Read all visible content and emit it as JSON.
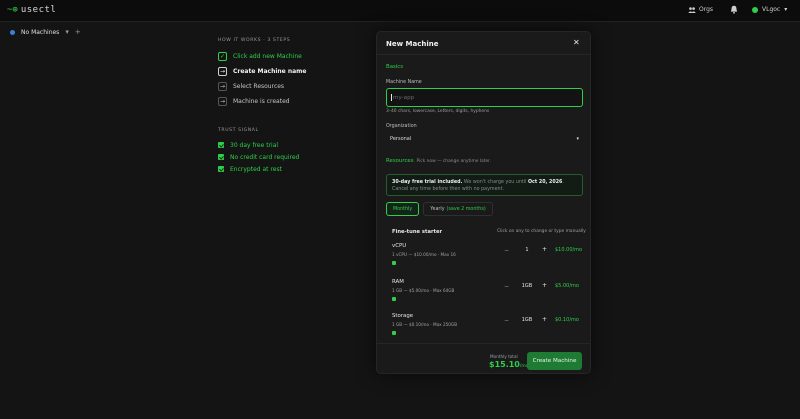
{
  "app": {
    "logo_glyph": "~⊕",
    "name": "usectl"
  },
  "topbar": {
    "orgs_label": "Orgs",
    "user_label": "VLgoc",
    "user_chevron": "▾"
  },
  "tabs": {
    "current": "No Machines",
    "chevron": "▾",
    "plus": "+"
  },
  "steps": {
    "heading": "HOW IT WORKS · 3 STEPS",
    "items": [
      {
        "label": "Click add new Machine",
        "state": "done",
        "mark": "✓"
      },
      {
        "label": "Create Machine name",
        "state": "current",
        "mark": "→"
      },
      {
        "label": "Select Resources",
        "state": "todo",
        "mark": "→"
      },
      {
        "label": "Machine is created",
        "state": "todo",
        "mark": "→"
      }
    ]
  },
  "trust": {
    "heading": "TRUST SIGNAL",
    "items": [
      "30 day free trial",
      "No credit card required",
      "Encrypted at rest"
    ]
  },
  "modal": {
    "title": "New Machine",
    "close": "✕",
    "basics": "Basics",
    "name_label": "Machine Name",
    "name_placeholder": "my-app",
    "name_hint": "3–40 chars, lowercase, Letters, digits, hyphens",
    "org_label": "Organization",
    "org_value": "Personal",
    "org_chevron": "▾",
    "resources": "Resources",
    "resources_sub": "Pick now — change anytime later.",
    "trial_bold": "30-day free trial included.",
    "trial_text_1": " We won't charge you until ",
    "trial_date": "Oct 20, 2026",
    "trial_text_2": ". Cancel any time before then with no payment.",
    "billing": {
      "monthly": "Monthly",
      "yearly": "Yearly",
      "yearly_save": "(save 2 months)"
    },
    "fine_tune_heading": "Fine-tune starter",
    "fine_tune_note": "Click on any to change or type manually",
    "resources_list": [
      {
        "name": "vCPU",
        "desc": "1 vCPU — $10.00/mo · Max 16",
        "minus": "−",
        "value": "1",
        "plus": "+",
        "price": "$10.00/mo"
      },
      {
        "name": "RAM",
        "desc": "1 GB — $5.00/mo · Max 64GB",
        "minus": "−",
        "value": "1GB",
        "plus": "+",
        "price": "$5.00/mo"
      },
      {
        "name": "Storage",
        "desc": "1 GB — $0.10/mo · Max 250GB",
        "minus": "−",
        "value": "1GB",
        "plus": "+",
        "price": "$0.10/mo"
      }
    ],
    "monthly_total_label": "Monthly total",
    "monthly_total": "$15.10",
    "per_month": "/mo",
    "create_button": "Create Machine"
  },
  "colors": {
    "accent": "#2fcf4a",
    "background": "#141414",
    "modal": "#1a1a1a"
  },
  "icons": {
    "orgs": "people-icon",
    "bell": "bell-icon",
    "close": "close-icon"
  }
}
